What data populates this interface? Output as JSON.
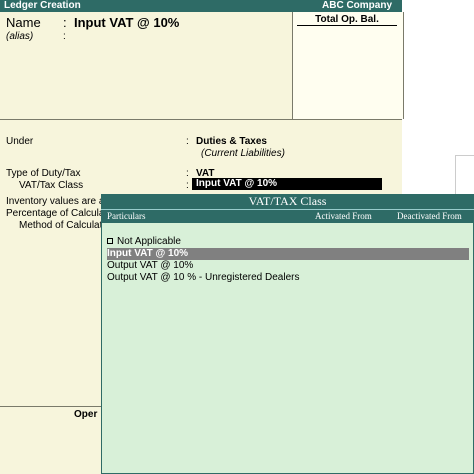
{
  "window": {
    "title": "Ledger Creation",
    "company": "ABC Company"
  },
  "ledger": {
    "name_label": "Name",
    "colon": ":",
    "name_value": "Input VAT @ 10%",
    "alias_label": "(alias)",
    "total_op_bal_label": "Total Op. Bal.",
    "under_label": "Under",
    "under_value": "Duties & Taxes",
    "under_sub": "(Current Liabilities)",
    "type_of_duty_label": "Type of Duty/Tax",
    "type_of_duty_value": "VAT",
    "vat_class_label": "VAT/Tax Class",
    "vat_class_value": "Input VAT @ 10%",
    "inventory_label": "Inventory values are a",
    "percentage_label": "Percentage of Calcula",
    "method_label": "Method of Calculat",
    "opening_label": "Oper"
  },
  "popup": {
    "title": "VAT/TAX Class",
    "col_particulars": "Particulars",
    "col_activated": "Activated From",
    "col_deactivated": "Deactivated From",
    "items": [
      {
        "label": "Not Applicable",
        "selected": false,
        "bullet": true
      },
      {
        "label": "Input VAT @ 10%",
        "selected": true,
        "bullet": false
      },
      {
        "label": "Output VAT @ 10%",
        "selected": false,
        "bullet": false
      },
      {
        "label": "Output VAT @ 10 % - Unregistered Dealers",
        "selected": false,
        "bullet": false
      }
    ]
  },
  "colors": {
    "title_bar": "#2e6b66",
    "ledger_bg": "#f7f5dc",
    "popup_bg": "#d8f0d8",
    "selection": "#808080"
  }
}
